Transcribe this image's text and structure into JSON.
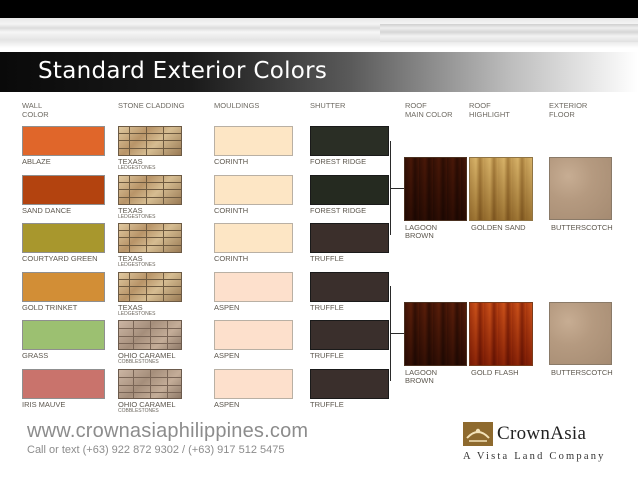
{
  "slide": {
    "title": "Standard Exterior Colors",
    "headers": {
      "wall": "WALL\nCOLOR",
      "stone": "STONE CLADDING",
      "mouldings": "MOULDINGS",
      "shutter": "SHUTTER",
      "roof_main": "ROOF\nMAIN COLOR",
      "roof_highlight": "ROOF\nHIGHLIGHT",
      "floor": "EXTERIOR\nFLOOR"
    },
    "rows": [
      {
        "wall": "ABLAZE",
        "wall_color": "#e0662a",
        "stone": "TEXAS",
        "stone_sub": "LEDGESTONES",
        "moulding": "CORINTH",
        "moulding_color": "#fde6c5",
        "shutter": "FOREST RIDGE",
        "shutter_color": "#2a2e25"
      },
      {
        "wall": "SAND DANCE",
        "wall_color": "#b3430f",
        "stone": "TEXAS",
        "stone_sub": "LEDGESTONES",
        "moulding": "CORINTH",
        "moulding_color": "#fde6c5",
        "shutter": "FOREST RIDGE",
        "shutter_color": "#252a20"
      },
      {
        "wall": "COURTYARD GREEN",
        "wall_color": "#a8972d",
        "stone": "TEXAS",
        "stone_sub": "LEDGESTONES",
        "moulding": "CORINTH",
        "moulding_color": "#fde6c5",
        "shutter": "TRUFFLE",
        "shutter_color": "#3b2f2b"
      },
      {
        "wall": "GOLD TRINKET",
        "wall_color": "#d28e36",
        "stone": "TEXAS",
        "stone_sub": "LEDGESTONES",
        "moulding": "ASPEN",
        "moulding_color": "#fde0cc",
        "shutter": "TRUFFLE",
        "shutter_color": "#3a2f2c"
      },
      {
        "wall": "GRASS",
        "wall_color": "#9cc071",
        "stone": "OHIO CARAMEL",
        "stone_sub": "COBBLESTONES",
        "moulding": "ASPEN",
        "moulding_color": "#fde0cc",
        "shutter": "TRUFFLE",
        "shutter_color": "#3a2f2c"
      },
      {
        "wall": "IRIS MAUVE",
        "wall_color": "#c9736c",
        "stone": "OHIO CARAMEL",
        "stone_sub": "COBBLESTONES",
        "moulding": "ASPEN",
        "moulding_color": "#fde0cc",
        "shutter": "TRUFFLE",
        "shutter_color": "#3a2f2c"
      }
    ],
    "groups": [
      {
        "roof_main": "LAGOON\nBROWN",
        "roof_highlight": "GOLDEN SAND",
        "floor": "BUTTERSCOTCH"
      },
      {
        "roof_main": "LAGOON\nBROWN",
        "roof_highlight": "GOLD FLASH",
        "floor": "BUTTERSCOTCH"
      }
    ]
  },
  "footer": {
    "url": "www.crownasiaphilippines.com",
    "call": "Call or text (+63) 922 872 9302 / (+63) 917 512 5475",
    "logo_name": "CrownAsia",
    "logo_tagline": "A Vista Land Company"
  },
  "colors": {
    "logo_gold": "#8e6a2e",
    "text_gray": "#8c8c8c"
  }
}
